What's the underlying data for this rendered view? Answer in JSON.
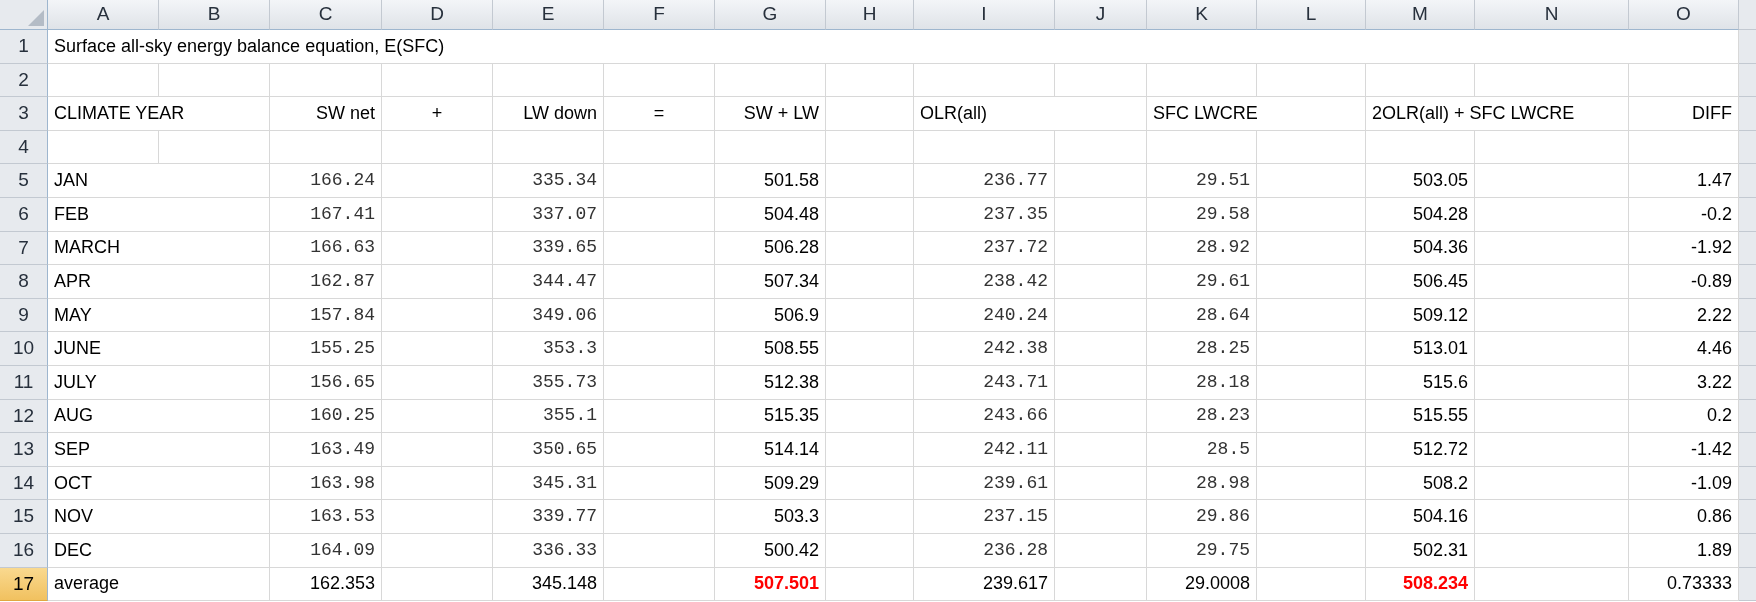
{
  "columns": [
    "A",
    "B",
    "C",
    "D",
    "E",
    "F",
    "G",
    "H",
    "I",
    "J",
    "K",
    "L",
    "M",
    "N",
    "O"
  ],
  "rows": [
    {
      "number": "1",
      "selected": false,
      "cells": [
        {
          "text": "Surface all-sky energy balance equation, E(SFC)",
          "kind": "label"
        },
        null,
        null,
        null,
        null,
        null,
        null,
        null,
        null,
        null,
        null,
        null,
        null,
        null,
        null
      ]
    },
    {
      "number": "2",
      "selected": false,
      "cells": [
        null,
        null,
        null,
        null,
        null,
        null,
        null,
        null,
        null,
        null,
        null,
        null,
        null,
        null,
        null
      ]
    },
    {
      "number": "3",
      "selected": false,
      "cells": [
        {
          "text": "CLIMATE YEAR",
          "kind": "label"
        },
        null,
        {
          "text": "SW net",
          "kind": "heading"
        },
        {
          "text": "+",
          "kind": "symbol"
        },
        {
          "text": "LW down",
          "kind": "heading"
        },
        {
          "text": "=",
          "kind": "symbol"
        },
        {
          "text": "SW + LW",
          "kind": "heading"
        },
        null,
        {
          "text": "OLR(all)",
          "kind": "label"
        },
        null,
        {
          "text": "SFC LWCRE",
          "kind": "label"
        },
        null,
        {
          "text": "2OLR(all) + SFC LWCRE",
          "kind": "label"
        },
        null,
        {
          "text": "DIFF",
          "kind": "heading"
        }
      ]
    },
    {
      "number": "4",
      "selected": false,
      "cells": [
        null,
        null,
        null,
        null,
        null,
        null,
        null,
        null,
        null,
        null,
        null,
        null,
        null,
        null,
        null
      ]
    },
    {
      "number": "5",
      "selected": false,
      "cells": [
        {
          "text": "JAN",
          "kind": "label"
        },
        null,
        {
          "text": "166.24",
          "kind": "input"
        },
        null,
        {
          "text": "335.34",
          "kind": "input"
        },
        null,
        {
          "text": "501.58",
          "kind": "result"
        },
        null,
        {
          "text": "236.77",
          "kind": "input"
        },
        null,
        {
          "text": "29.51",
          "kind": "input"
        },
        null,
        {
          "text": "503.05",
          "kind": "result"
        },
        null,
        {
          "text": "1.47",
          "kind": "result"
        }
      ]
    },
    {
      "number": "6",
      "selected": false,
      "cells": [
        {
          "text": "FEB",
          "kind": "label"
        },
        null,
        {
          "text": "167.41",
          "kind": "input"
        },
        null,
        {
          "text": "337.07",
          "kind": "input"
        },
        null,
        {
          "text": "504.48",
          "kind": "result"
        },
        null,
        {
          "text": "237.35",
          "kind": "input"
        },
        null,
        {
          "text": "29.58",
          "kind": "input"
        },
        null,
        {
          "text": "504.28",
          "kind": "result"
        },
        null,
        {
          "text": "-0.2",
          "kind": "result"
        }
      ]
    },
    {
      "number": "7",
      "selected": false,
      "cells": [
        {
          "text": "MARCH",
          "kind": "label"
        },
        null,
        {
          "text": "166.63",
          "kind": "input"
        },
        null,
        {
          "text": "339.65",
          "kind": "input"
        },
        null,
        {
          "text": "506.28",
          "kind": "result"
        },
        null,
        {
          "text": "237.72",
          "kind": "input"
        },
        null,
        {
          "text": "28.92",
          "kind": "input"
        },
        null,
        {
          "text": "504.36",
          "kind": "result"
        },
        null,
        {
          "text": "-1.92",
          "kind": "result"
        }
      ]
    },
    {
      "number": "8",
      "selected": false,
      "cells": [
        {
          "text": "APR",
          "kind": "label"
        },
        null,
        {
          "text": "162.87",
          "kind": "input"
        },
        null,
        {
          "text": "344.47",
          "kind": "input"
        },
        null,
        {
          "text": "507.34",
          "kind": "result"
        },
        null,
        {
          "text": "238.42",
          "kind": "input"
        },
        null,
        {
          "text": "29.61",
          "kind": "input"
        },
        null,
        {
          "text": "506.45",
          "kind": "result"
        },
        null,
        {
          "text": "-0.89",
          "kind": "result"
        }
      ]
    },
    {
      "number": "9",
      "selected": false,
      "cells": [
        {
          "text": "MAY",
          "kind": "label"
        },
        null,
        {
          "text": "157.84",
          "kind": "input"
        },
        null,
        {
          "text": "349.06",
          "kind": "input"
        },
        null,
        {
          "text": "506.9",
          "kind": "result"
        },
        null,
        {
          "text": "240.24",
          "kind": "input"
        },
        null,
        {
          "text": "28.64",
          "kind": "input"
        },
        null,
        {
          "text": "509.12",
          "kind": "result"
        },
        null,
        {
          "text": "2.22",
          "kind": "result"
        }
      ]
    },
    {
      "number": "10",
      "selected": false,
      "cells": [
        {
          "text": "JUNE",
          "kind": "label"
        },
        null,
        {
          "text": "155.25",
          "kind": "input"
        },
        null,
        {
          "text": "353.3",
          "kind": "input"
        },
        null,
        {
          "text": "508.55",
          "kind": "result"
        },
        null,
        {
          "text": "242.38",
          "kind": "input"
        },
        null,
        {
          "text": "28.25",
          "kind": "input"
        },
        null,
        {
          "text": "513.01",
          "kind": "result"
        },
        null,
        {
          "text": "4.46",
          "kind": "result"
        }
      ]
    },
    {
      "number": "11",
      "selected": false,
      "cells": [
        {
          "text": "JULY",
          "kind": "label"
        },
        null,
        {
          "text": "156.65",
          "kind": "input"
        },
        null,
        {
          "text": "355.73",
          "kind": "input"
        },
        null,
        {
          "text": "512.38",
          "kind": "result"
        },
        null,
        {
          "text": "243.71",
          "kind": "input"
        },
        null,
        {
          "text": "28.18",
          "kind": "input"
        },
        null,
        {
          "text": "515.6",
          "kind": "result"
        },
        null,
        {
          "text": "3.22",
          "kind": "result"
        }
      ]
    },
    {
      "number": "12",
      "selected": false,
      "cells": [
        {
          "text": "AUG",
          "kind": "label"
        },
        null,
        {
          "text": "160.25",
          "kind": "input"
        },
        null,
        {
          "text": "355.1",
          "kind": "input"
        },
        null,
        {
          "text": "515.35",
          "kind": "result"
        },
        null,
        {
          "text": "243.66",
          "kind": "input"
        },
        null,
        {
          "text": "28.23",
          "kind": "input"
        },
        null,
        {
          "text": "515.55",
          "kind": "result"
        },
        null,
        {
          "text": "0.2",
          "kind": "result"
        }
      ]
    },
    {
      "number": "13",
      "selected": false,
      "cells": [
        {
          "text": "SEP",
          "kind": "label"
        },
        null,
        {
          "text": "163.49",
          "kind": "input"
        },
        null,
        {
          "text": "350.65",
          "kind": "input"
        },
        null,
        {
          "text": "514.14",
          "kind": "result"
        },
        null,
        {
          "text": "242.11",
          "kind": "input"
        },
        null,
        {
          "text": "28.5",
          "kind": "input"
        },
        null,
        {
          "text": "512.72",
          "kind": "result"
        },
        null,
        {
          "text": "-1.42",
          "kind": "result"
        }
      ]
    },
    {
      "number": "14",
      "selected": false,
      "cells": [
        {
          "text": "OCT",
          "kind": "label"
        },
        null,
        {
          "text": "163.98",
          "kind": "input"
        },
        null,
        {
          "text": "345.31",
          "kind": "input"
        },
        null,
        {
          "text": "509.29",
          "kind": "result"
        },
        null,
        {
          "text": "239.61",
          "kind": "input"
        },
        null,
        {
          "text": "28.98",
          "kind": "input"
        },
        null,
        {
          "text": "508.2",
          "kind": "result"
        },
        null,
        {
          "text": "-1.09",
          "kind": "result"
        }
      ]
    },
    {
      "number": "15",
      "selected": false,
      "cells": [
        {
          "text": "NOV",
          "kind": "label"
        },
        null,
        {
          "text": "163.53",
          "kind": "input"
        },
        null,
        {
          "text": "339.77",
          "kind": "input"
        },
        null,
        {
          "text": "503.3",
          "kind": "result"
        },
        null,
        {
          "text": "237.15",
          "kind": "input"
        },
        null,
        {
          "text": "29.86",
          "kind": "input"
        },
        null,
        {
          "text": "504.16",
          "kind": "result"
        },
        null,
        {
          "text": "0.86",
          "kind": "result"
        }
      ]
    },
    {
      "number": "16",
      "selected": false,
      "cells": [
        {
          "text": "DEC",
          "kind": "label"
        },
        null,
        {
          "text": "164.09",
          "kind": "input"
        },
        null,
        {
          "text": "336.33",
          "kind": "input"
        },
        null,
        {
          "text": "500.42",
          "kind": "result"
        },
        null,
        {
          "text": "236.28",
          "kind": "input"
        },
        null,
        {
          "text": "29.75",
          "kind": "input"
        },
        null,
        {
          "text": "502.31",
          "kind": "result"
        },
        null,
        {
          "text": "1.89",
          "kind": "result"
        }
      ]
    },
    {
      "number": "17",
      "selected": true,
      "cells": [
        {
          "text": "average",
          "kind": "label"
        },
        null,
        {
          "text": "162.353",
          "kind": "result"
        },
        null,
        {
          "text": "345.148",
          "kind": "result"
        },
        null,
        {
          "text": "507.501",
          "kind": "flagged"
        },
        null,
        {
          "text": "239.617",
          "kind": "result"
        },
        null,
        {
          "text": "29.0008",
          "kind": "result"
        },
        null,
        {
          "text": "508.234",
          "kind": "flagged"
        },
        null,
        {
          "text": "0.73333",
          "kind": "result"
        }
      ]
    }
  ]
}
